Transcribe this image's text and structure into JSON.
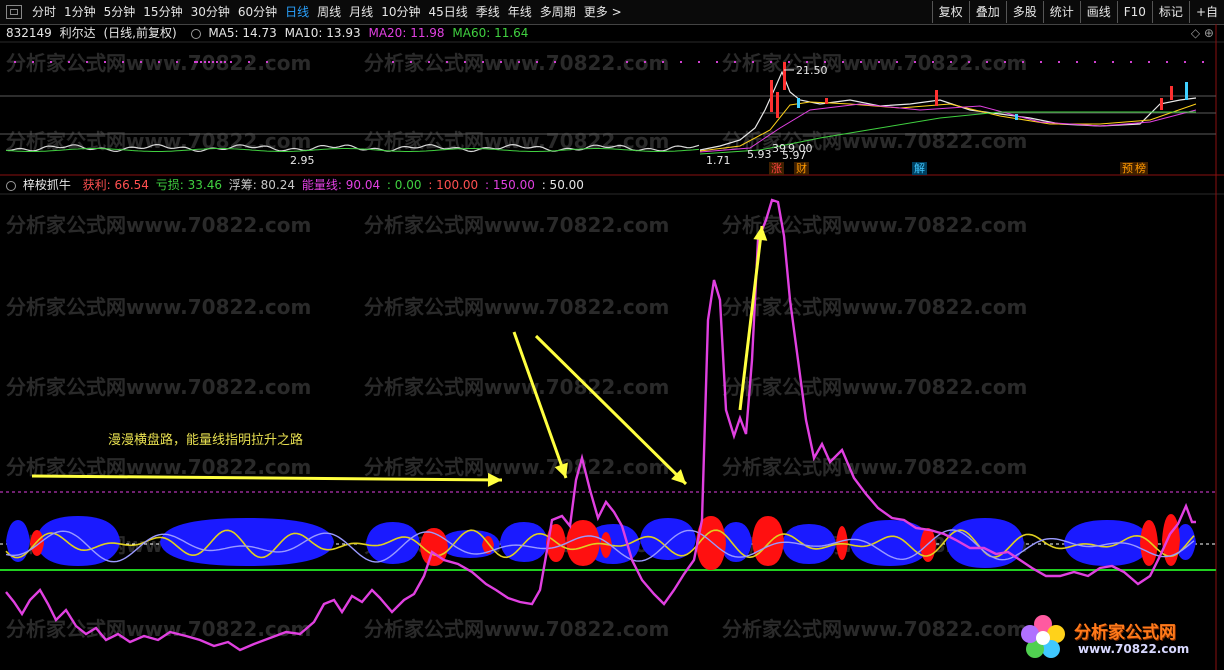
{
  "toolbar": {
    "periods": [
      "分时",
      "1分钟",
      "5分钟",
      "15分钟",
      "30分钟",
      "60分钟",
      "日线",
      "周线",
      "月线",
      "10分钟",
      "45日线",
      "季线",
      "年线",
      "多周期",
      "更多 >"
    ],
    "active_period": "日线",
    "right_buttons": [
      "复权",
      "叠加",
      "多股",
      "统计",
      "画线",
      "F10",
      "标记",
      "+自"
    ]
  },
  "main_info": {
    "code": "832149",
    "name": "利尔达",
    "period_label": "(日线,前复权)",
    "ma5_label": "MA5:",
    "ma5": "14.73",
    "ma10_label": "MA10:",
    "ma10": "13.93",
    "ma20_label": "MA20:",
    "ma20": "11.98",
    "ma60_label": "MA60:",
    "ma60": "11.64",
    "right_icons": "◇  ⊕"
  },
  "price_labels": {
    "high": "21.50",
    "low": "2.95",
    "mark_a": "39",
    "mark_b": "9.00",
    "mark_c": "5.93",
    "mark_d": "5.97",
    "mark_e": "1.71"
  },
  "event_tags": [
    {
      "text": "涨",
      "color": "#ff4040"
    },
    {
      "text": "财",
      "color": "#ff9a00"
    },
    {
      "text": "解",
      "color": "#40c8ff"
    },
    {
      "text": "预",
      "color": "#ff9a00"
    },
    {
      "text": "榜",
      "color": "#ff9a00"
    }
  ],
  "indicator_info": {
    "name": "梓桉抓牛",
    "profit_label": "获利:",
    "profit": "66.54",
    "loss_label": "亏损:",
    "loss": "33.46",
    "float_label": "浮筹:",
    "float": "80.24",
    "energy_label": "能量线:",
    "energy": "90.04",
    "v1": ": 0.00",
    "v2": ": 100.00",
    "v3": ": 150.00",
    "v4": ": 50.00"
  },
  "annotation": "漫漫横盘路，能量线指明拉升之路",
  "watermark": "分析家公式网www.70822.com",
  "logo": {
    "title": "分析家公式网",
    "url": "www.70822.com"
  },
  "colors": {
    "energy_line": "#e040e0",
    "arrow": "#ffff40",
    "profit": "#ff5050",
    "loss": "#40d040",
    "band_blue": "#1a1aff",
    "band_red": "#ff1010",
    "baseline": "#20d020"
  }
}
